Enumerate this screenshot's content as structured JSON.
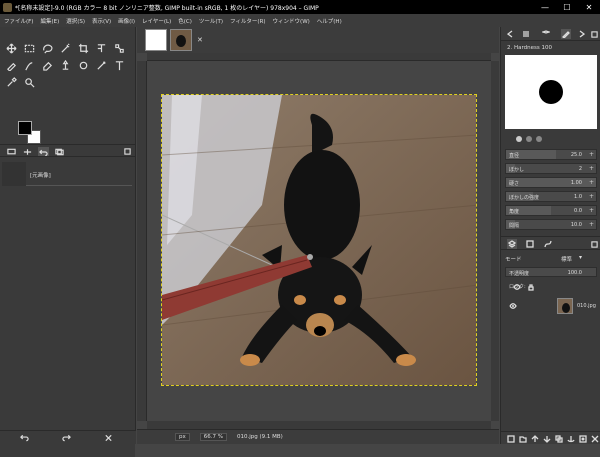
{
  "window": {
    "title": "*[名称未設定]-9.0 (RGB カラー 8 bit ノンリニア整数, GIMP built-in sRGB, 1 枚のレイヤー) 978x904 – GIMP",
    "minimize": "—",
    "maximize": "☐",
    "close": "✕"
  },
  "menu": [
    "ファイル(F)",
    "編集(E)",
    "選択(S)",
    "表示(V)",
    "画像(I)",
    "レイヤー(L)",
    "色(C)",
    "ツール(T)",
    "フィルター(R)",
    "ウィンドウ(W)",
    "ヘルプ(H)"
  ],
  "toolbox": {
    "tools": [
      "move",
      "rect-select",
      "free-select",
      "fuzzy-select",
      "crop",
      "transform",
      "warp",
      "paint",
      "smudge",
      "eraser",
      "clone",
      "heal",
      "ink",
      "text",
      "color-picker",
      "zoom"
    ],
    "tool_options_item": "[元画像]"
  },
  "image_tabs": {
    "close": "✕"
  },
  "statusbar": {
    "unit": "px",
    "zoom": "66.7 %",
    "info": "010.jpg (9.1 MB)"
  },
  "brushes": {
    "name": "2. Hardness 100"
  },
  "brush_options": [
    {
      "label": "直径",
      "value": "25.0",
      "fill": 0.55
    },
    {
      "label": "ぼかし",
      "value": "2",
      "fill": 0.1
    },
    {
      "label": "硬さ",
      "value": "1.00",
      "fill": 1.0
    },
    {
      "label": "ぼかしの強度",
      "value": "1.0",
      "fill": 0.3
    },
    {
      "label": "角度",
      "value": "0.0",
      "fill": 0.5
    },
    {
      "label": "間隔",
      "value": "10.0",
      "fill": 0.1
    }
  ],
  "layers": {
    "mode_label": "モード",
    "mode_value": "標準",
    "opacity_label": "不透明度",
    "opacity_value": "100.0",
    "lock_label": "ロック:",
    "layer_name": "010.jpg"
  },
  "colors": {
    "accent": "#e0d020",
    "background": "#454545",
    "panel": "#3a3a3a"
  }
}
